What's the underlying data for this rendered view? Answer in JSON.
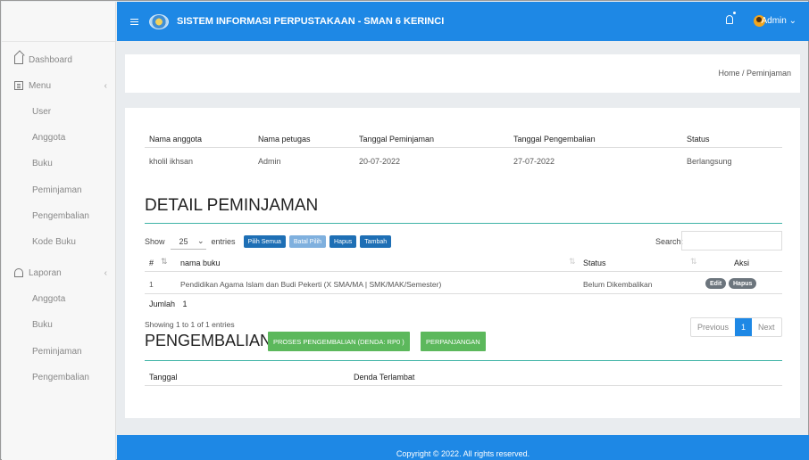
{
  "app": {
    "title": "SISTEM INFORMASI PERPUSTAKAAN - SMAN 6 KERINCI",
    "user": "Admin ⌄"
  },
  "sidebar": {
    "dashboard": "Dashboard",
    "menu": "Menu",
    "menu_items": [
      "User",
      "Anggota",
      "Buku",
      "Peminjaman",
      "Pengembalian",
      "Kode Buku"
    ],
    "laporan": "Laporan",
    "laporan_items": [
      "Anggota",
      "Buku",
      "Peminjaman",
      "Pengembalian"
    ]
  },
  "breadcrumb": "Home / Peminjaman",
  "loan_info": {
    "headers": [
      "Nama anggota",
      "Nama petugas",
      "Tanggal Peminjaman",
      "Tanggal Pengembalian",
      "Status"
    ],
    "values": [
      "kholil ikhsan",
      "Admin",
      "20-07-2022",
      "27-07-2022",
      "Berlangsung"
    ]
  },
  "detail": {
    "heading": "DETAIL PEMINJAMAN",
    "show_label": "Show",
    "entries_value": "25",
    "entries_label": "entries",
    "buttons": [
      "Pilih Semua",
      "Batal Pilih",
      "Hapus",
      "Tambah"
    ],
    "search_label": "Search:",
    "columns": [
      "#",
      "nama buku",
      "Status",
      "Aksi"
    ],
    "rows": [
      {
        "no": "1",
        "book": "Pendidikan Agama Islam dan Budi Pekerti (X SMA/MA | SMK/MAK/Semester)",
        "status": "Belum Dikembalikan",
        "edit": "Edit",
        "hapus": "Hapus"
      }
    ],
    "jumlah_label": "Jumlah",
    "jumlah_value": "1",
    "showing": "Showing 1 to 1 of 1 entries",
    "pager": {
      "previous": "Previous",
      "page": "1",
      "next": "Next"
    }
  },
  "pengembalian": {
    "heading": "PENGEMBALIAN",
    "proses_button": "PROSES PENGEMBALIAN (DENDA: RP0 )",
    "perpanjangan_button": "PERPANJANGAN",
    "columns": [
      "Tanggal",
      "Denda Terlambat"
    ]
  },
  "footer": "Copyright © 2022. All rights reserved."
}
